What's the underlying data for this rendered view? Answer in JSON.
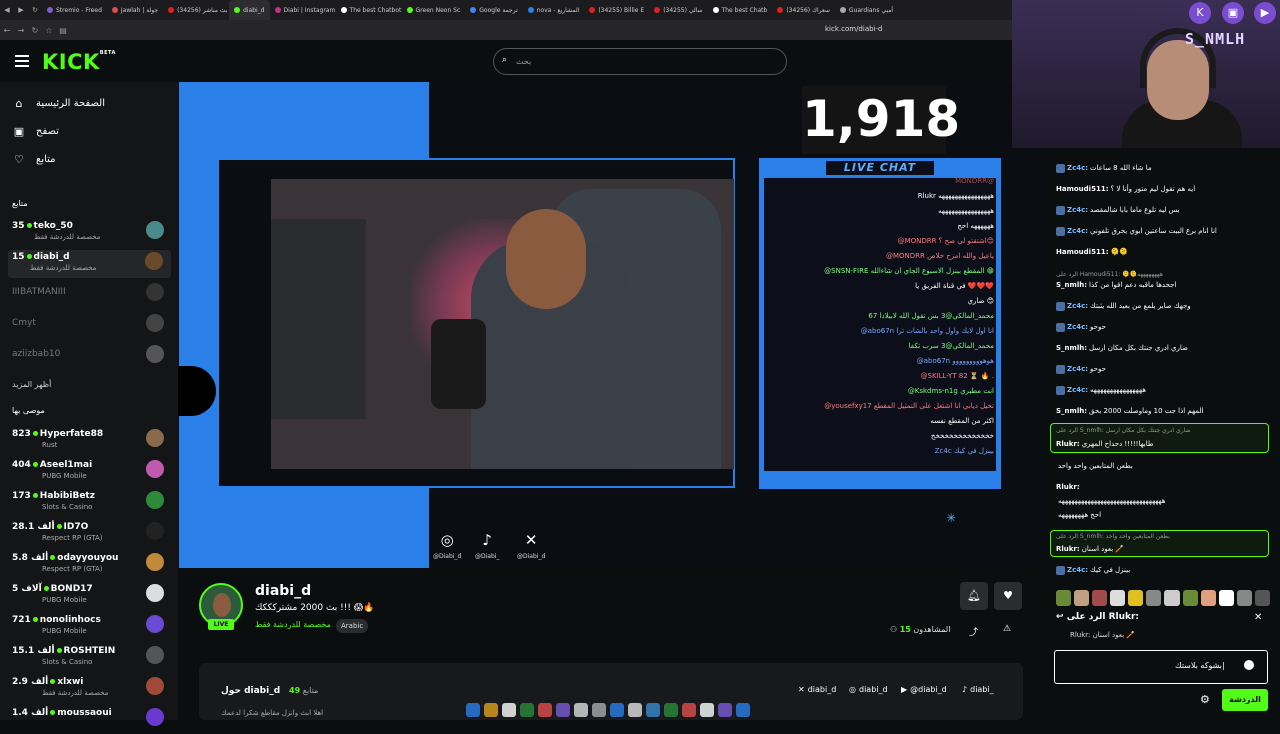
{
  "browser": {
    "tabs": [
      {
        "label": "Stremio - Freed",
        "color": "#7b5bd6"
      },
      {
        "label": "Jawlah | جولة",
        "color": "#e04e4e"
      },
      {
        "label": "(34256) بث مباشر",
        "color": "#e02020"
      },
      {
        "label": "diabi_d",
        "color": "#53fc18"
      },
      {
        "label": "Diabi | Instagram",
        "color": "#c13584"
      },
      {
        "label": "The best Chatbot",
        "color": "#ffffff"
      },
      {
        "label": "Green Neon Sc",
        "color": "#53fc18"
      },
      {
        "label": "Google ترجمة",
        "color": "#4285f4"
      },
      {
        "label": "nova - المشاريع",
        "color": "#2a7fe8"
      },
      {
        "label": "(34255) Billie E",
        "color": "#e02020"
      },
      {
        "label": "(34255) سالي",
        "color": "#e02020"
      },
      {
        "label": "The best Chatb",
        "color": "#ffffff"
      },
      {
        "label": "(34256) سعراك",
        "color": "#e02020"
      },
      {
        "label": "Guardians أمبي",
        "color": "#aaaaaa"
      }
    ],
    "url": "kick.com/diabi-d"
  },
  "kick": {
    "logo": "KICK",
    "logo_beta": "BETA",
    "search_placeholder": "بحث"
  },
  "sidebar": {
    "nav": [
      {
        "label": "الصفحة الرئيسية",
        "icon": "home-icon",
        "glyph": "⌂"
      },
      {
        "label": "تصفح",
        "icon": "browse-icon",
        "glyph": "▣"
      },
      {
        "label": "متابع",
        "icon": "heart-icon",
        "glyph": "♡"
      }
    ],
    "following_title": "متابع",
    "following": [
      {
        "count": "35",
        "name": "teko_50",
        "sub": "مخصصة للدردشة فقط",
        "live": true,
        "color": "#4a8a8a"
      },
      {
        "count": "15",
        "name": "diabi_d",
        "sub": "مخصصة للدردشة فقط",
        "live": true,
        "color": "#6a4a2a",
        "selected": true
      },
      {
        "name": "IIIBATMANIII",
        "live": false,
        "color": "#333"
      },
      {
        "name": "Cmyt",
        "live": false,
        "color": "#444"
      },
      {
        "name": "aziizbab10",
        "live": false,
        "color": "#555"
      }
    ],
    "show_more": "أظهر المزيد",
    "recommended_title": "موصى بها",
    "recommended": [
      {
        "count": "823",
        "name": "Hyperfate88",
        "sub": "Rust",
        "color": "#8a6a4a"
      },
      {
        "count": "404",
        "name": "Aseel1mai",
        "sub": "PUBG Mobile",
        "color": "#c05ab0"
      },
      {
        "count": "173",
        "name": "HabibiBetz",
        "sub": "Slots & Casino",
        "color": "#2c8a3a"
      },
      {
        "count": "28.1 ألف",
        "name": "ID7O",
        "sub": "Respect RP (GTA)",
        "color": "#222"
      },
      {
        "count": "5.8 ألف",
        "name": "odayyouyou",
        "sub": "Respect RP (GTA)",
        "color": "#c08a3a"
      },
      {
        "count": "5 آلاف",
        "name": "BOND17",
        "sub": "PUBG Mobile",
        "color": "#ddd"
      },
      {
        "count": "721",
        "name": "nonolinhocs",
        "sub": "PUBG Mobile",
        "color": "#6a4ad0"
      },
      {
        "count": "15.1 ألف",
        "name": "ROSHTEIN",
        "sub": "Slots & Casino",
        "color": "#555"
      },
      {
        "count": "2.9 ألف",
        "name": "xlxwi",
        "sub": "مخصصة للدردشة فقط",
        "color": "#a04a3a"
      },
      {
        "count": "1.4 ألف",
        "name": "moussaoui",
        "sub": "",
        "color": "#6a3ad0"
      }
    ]
  },
  "player": {
    "viewer_overlay": "1,918",
    "live_chat_label": "LIVE CHAT",
    "overlay_chat": [
      {
        "text": "MONDRR@",
        "color": "#ff7a7a",
        "dim": true
      },
      {
        "text": "Rlukr ههههههههههههههههه",
        "color": "#ffffff"
      },
      {
        "text": "ههههههههههههههههه",
        "color": "#ffffff"
      },
      {
        "text": "ههههههه احح",
        "color": "#ffffff"
      },
      {
        "text": "@MONDRR اشتقتو لي صح ؟😊",
        "color": "#ff7a7a"
      },
      {
        "text": "@MONDRR ياعيل والله امزح خلاص",
        "color": "#ff7a7a"
      },
      {
        "text": "@SNSN-FIRE المقطع بينزل الاسبوع الجاي ان شاءالله 😁",
        "color": "#7aff7a"
      },
      {
        "text": "في قناة الفريق يا ❤️❤️❤️",
        "color": "#ffffff"
      },
      {
        "text": "ضاري 😊",
        "color": "#ffffff"
      },
      {
        "text": "محمد_المالكي@3 بس تقول الله لابيلادا 67",
        "color": "#7aff7a"
      },
      {
        "text": "@abo67n انا اول لايك واول واحد بالشات ترا",
        "color": "#7aa8ff"
      },
      {
        "text": "محمد_المالكي@3 سرب تكفا",
        "color": "#7aff7a"
      },
      {
        "text": "@abo67n هوهووووووووو",
        "color": "#7aa8ff"
      },
      {
        "text": "@SKILL-YT 82 ⏳ 🔥 .",
        "color": "#ff7a7a"
      },
      {
        "text": "@Kskdms-n1g انت مطيري",
        "color": "#7aff7a"
      },
      {
        "text": "@yousefxy17 تخيل ديابي انا اشتغل على التمثيل المقطع",
        "color": "#ff7a7a"
      },
      {
        "text": "اكثر من المقطع نفسه",
        "color": "#ffffff"
      },
      {
        "text": "خخخخخخخخخخخخخخ",
        "color": "#ffffff"
      },
      {
        "text": "Zc4c بينزل في كيك",
        "color": "#7aa8ff"
      }
    ],
    "socials": [
      {
        "label": "@Diabi_d",
        "icon": "instagram-icon",
        "glyph": "◎"
      },
      {
        "label": "@Diabi_",
        "icon": "tiktok-icon",
        "glyph": "♪"
      },
      {
        "label": "@Diabi_d",
        "icon": "x-icon",
        "glyph": "✕"
      }
    ]
  },
  "channel": {
    "name": "diabi_d",
    "live_badge": "LIVE",
    "title": "بث 2000 مشتركككك !!! 😱🔥",
    "chat_mode": "مخصصة للدردشة فقط",
    "language": "Arabic",
    "viewers_label": "المشاهدون",
    "viewers": "15",
    "about_title": "حول diabi_d",
    "followers_label": "متابع",
    "followers": "49",
    "about_sub": "اهلا ابث وانزل مقاطع شكرا لدعمك",
    "socials": [
      {
        "label": "diabi_d",
        "icon": "x-icon",
        "glyph": "✕"
      },
      {
        "label": "diabi_d",
        "icon": "instagram-icon",
        "glyph": "◎"
      },
      {
        "label": "@diabi_d",
        "icon": "youtube-icon",
        "glyph": "▶"
      },
      {
        "label": "diabi_",
        "icon": "tiktok-icon",
        "glyph": "♪"
      }
    ]
  },
  "webcam": {
    "brand": "S_NMLH"
  },
  "chat": {
    "messages": [
      {
        "user": "Zc4c:",
        "text": "ما شاء الله 8 ساعات",
        "badge": true,
        "blue": true
      },
      {
        "user": "Hamoudi511:",
        "text": "ايه هم تقول ليم متور وأنا لا ؟",
        "badge": false
      },
      {
        "user": "Zc4c:",
        "text": "بس ليه تلوع ماما بابا شالمقصد",
        "badge": true,
        "blue": true
      },
      {
        "user": "Zc4c:",
        "text": "انا انام برع البيت ساعتين ابوي يحرق تلفوني",
        "badge": true,
        "blue": true
      },
      {
        "user": "Hamoudi511:",
        "text": "🫠🫠",
        "badge": false
      },
      {
        "meta": "الرد على Hamoudi511: 🫠🫠ههههههههه"
      },
      {
        "user": "S_nmlh:",
        "text": "اجحدها ماقبه دعم اقوا من كذا",
        "badge": false
      },
      {
        "user": "Zc4c:",
        "text": "وجهك صابر يلمع من بعيد الله يثبتك",
        "badge": true,
        "blue": true
      },
      {
        "user": "Zc4c:",
        "text": "حوحو",
        "badge": true,
        "blue": true
      },
      {
        "user": "S_nmlh:",
        "text": "ضاري ادري جنتك بكل مكان ارسل",
        "badge": false
      },
      {
        "user": "Zc4c:",
        "text": "حوحو",
        "badge": true,
        "blue": true
      },
      {
        "user": "Zc4c:",
        "text": "ههههههههههههههههه",
        "badge": true,
        "blue": true
      },
      {
        "user": "S_nmlh:",
        "text": "المهم اذا جت 10 وماوصلت 2000 بحق",
        "badge": false
      }
    ],
    "reply1": {
      "meta": "الرد على S_nmlh: ضاري ادري جنتك بكل مكان ارسل",
      "user": "Rlukr:",
      "text": "طابها!!!!! دحداح المهري"
    },
    "mid": [
      {
        "user": "",
        "text": "بطعن المتابعين واحد واحد",
        "badge": false
      },
      {
        "user": "Rlukr:",
        "text": "",
        "badge": false
      },
      {
        "user": "",
        "text": "ههههههههههههههههههههههههههههههههه",
        "badge": false
      },
      {
        "user": "",
        "text": "احح ههههههههه",
        "badge": false
      }
    ],
    "reply2": {
      "meta": "الرد على S_nmlh: بطعن المتابعين واحد واحد",
      "user": "Rlukr:",
      "text": "بعود اسنان 🪥"
    },
    "last": {
      "user": "Zc4c:",
      "text": "بينزل في كيك",
      "badge": true
    },
    "replying_to_label": "الرد على Rlukr:",
    "replying_to_msg": "Rlukr: بعود اسنان 🪥",
    "input_value": "بشوكه بلاستك",
    "send_label": "الدردشة"
  }
}
